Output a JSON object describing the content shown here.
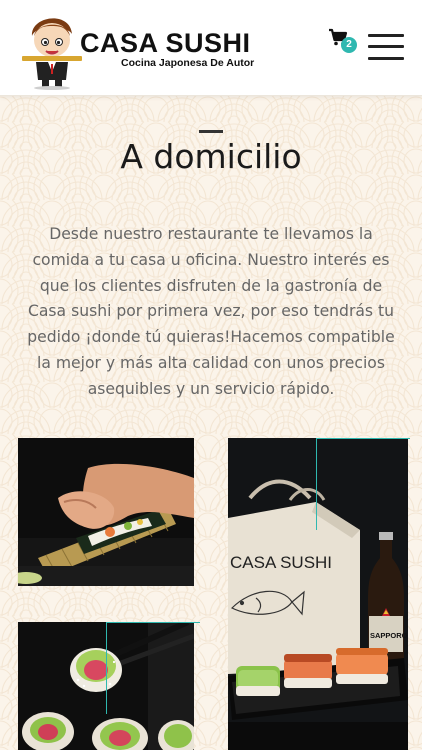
{
  "header": {
    "brand_name": "CASA SUSHI",
    "brand_tagline": "Cocina Japonesa De Autor",
    "cart_count": "2"
  },
  "main": {
    "title": "A domicilio",
    "intro": "Desde nuestro restaurante te llevamos la comida a tu casa u oficina. Nuestro interés es que los clientes disfruten de la gastronía de Casa sushi por primera vez, por eso tendrás tu pedido ¡donde tú quieras!Hacemos compatible la mejor y más alta calidad con unos precios asequibles y un servicio rápido."
  },
  "photos": {
    "bag_text": "CASA SUSHI",
    "beer_label": "SAPPORO"
  },
  "colors": {
    "accent": "#2fb8b0",
    "background": "#fbf4ea"
  },
  "icons": [
    "cart-icon",
    "menu-icon"
  ]
}
